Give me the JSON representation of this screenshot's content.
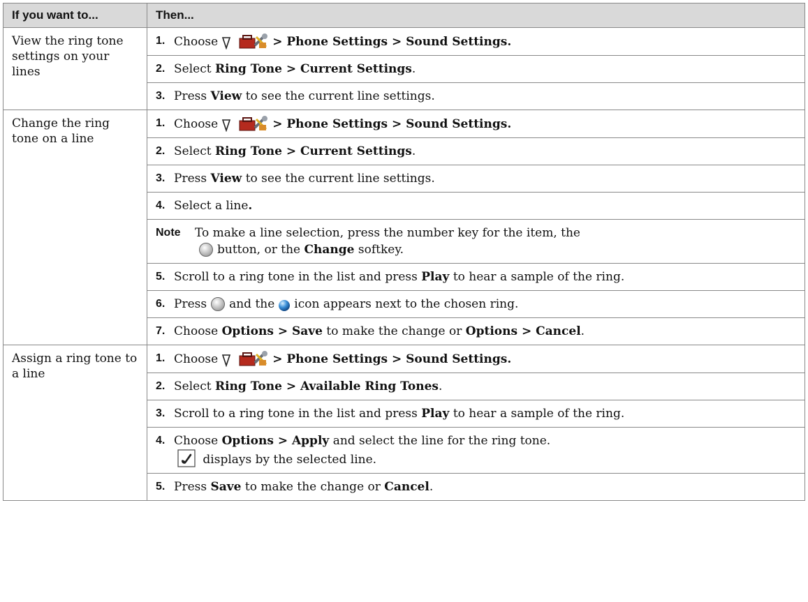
{
  "header": {
    "col1": "If you want to...",
    "col2": "Then..."
  },
  "labels": {
    "choose": "Choose",
    "phone_settings_path": "> Phone Settings > Sound Settings.",
    "select": "Select",
    "ring_tone_current": "Ring Tone > Current Settings",
    "ring_tone_available": "Ring Tone > Available Ring Tones",
    "period": ".",
    "press": "Press",
    "view": "View",
    "view_rest": "to see the current line settings.",
    "select_line": "Select a line",
    "note_label": "Note",
    "note_text_1": "To make a line selection, press the number key for the item, the",
    "note_text_2": "button, or the",
    "change": "Change",
    "softkey": "softkey.",
    "scroll_text": "Scroll to a ring tone in the list and press",
    "play": "Play",
    "scroll_rest": "to hear a sample of the ring.",
    "and_the": "and the",
    "icon_appears": "icon appears next to the chosen ring.",
    "options_save": "Options > Save",
    "to_make_change_or": "to make the change or",
    "options_cancel": "Options > Cancel",
    "options_apply": "Options > Apply",
    "apply_rest": "and select the line for the ring tone.",
    "displays_by": "displays by the selected line.",
    "save": "Save",
    "cancel": "Cancel"
  },
  "rows": [
    {
      "task": "View the ring tone settings on your lines"
    },
    {
      "task": "Change the ring tone on a line"
    },
    {
      "task": "Assign a ring tone to a line"
    }
  ],
  "nums": [
    "1.",
    "2.",
    "3.",
    "4.",
    "5.",
    "6.",
    "7."
  ],
  "icons": [
    "nav-down-icon",
    "settings-toolbox-icon",
    "select-button-icon",
    "selected-ball-icon",
    "phone-checkmark-icon"
  ]
}
